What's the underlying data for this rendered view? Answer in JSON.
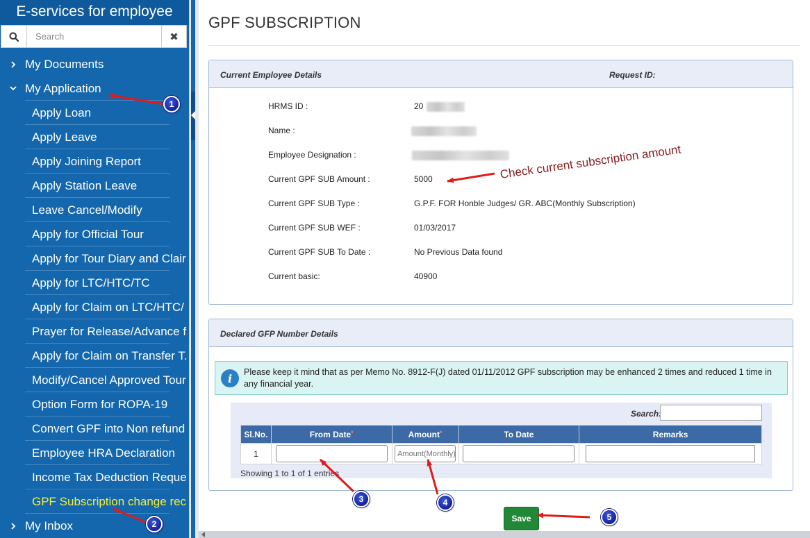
{
  "sidebar": {
    "title": "E-services for employee",
    "search_placeholder": "Search",
    "search_icon": "search-icon",
    "clear_icon": "close-icon",
    "clear_glyph": "✖",
    "items": [
      {
        "label": "My Documents",
        "level": "top",
        "chevron": "›"
      },
      {
        "label": "My Application",
        "level": "top",
        "chevron": "⌄"
      },
      {
        "label": "Apply Loan",
        "level": "sub"
      },
      {
        "label": "Apply Leave",
        "level": "sub"
      },
      {
        "label": "Apply Joining Report",
        "level": "sub"
      },
      {
        "label": "Apply Station Leave",
        "level": "sub"
      },
      {
        "label": "Leave Cancel/Modify",
        "level": "sub"
      },
      {
        "label": "Apply for Official Tour",
        "level": "sub"
      },
      {
        "label": "Apply for Tour Diary and Clair",
        "level": "sub"
      },
      {
        "label": "Apply for LTC/HTC/TC",
        "level": "sub"
      },
      {
        "label": "Apply for Claim on LTC/HTC/",
        "level": "sub"
      },
      {
        "label": "Prayer for Release/Advance f",
        "level": "sub"
      },
      {
        "label": "Apply for Claim on Transfer T.",
        "level": "sub"
      },
      {
        "label": "Modify/Cancel Approved Tour",
        "level": "sub"
      },
      {
        "label": "Option Form for ROPA-19",
        "level": "sub"
      },
      {
        "label": "Convert GPF into Non refund",
        "level": "sub"
      },
      {
        "label": "Employee HRA Declaration",
        "level": "sub"
      },
      {
        "label": "Income Tax Deduction Reque",
        "level": "sub"
      },
      {
        "label": "GPF Subscription change rec",
        "level": "sub",
        "active": true
      },
      {
        "label": "My Inbox",
        "level": "top",
        "chevron": "›"
      }
    ],
    "active_color": "#f3ef3c",
    "bg_color": "#1466ad"
  },
  "page": {
    "title": "GPF SUBSCRIPTION"
  },
  "employee_panel": {
    "heading": "Current Employee Details",
    "request_label": "Request ID:",
    "rows": [
      {
        "label": "HRMS ID :",
        "value": "20",
        "blurred": true
      },
      {
        "label": "Name :",
        "value": "",
        "blurred": true
      },
      {
        "label": "Employee Designation :",
        "value": "",
        "blurred": true
      },
      {
        "label": "Current GPF SUB Amount :",
        "value": "5000"
      },
      {
        "label": "Current GPF SUB Type :",
        "value": "G.P.F. FOR Honble Judges/ GR. ABC(Monthly Subscription)"
      },
      {
        "label": "Current GPF SUB WEF :",
        "value": "01/03/2017"
      },
      {
        "label": "Current GPF SUB To Date :",
        "value": "No Previous Data found"
      },
      {
        "label": "Current basic:",
        "value": "40900"
      }
    ]
  },
  "annotation": {
    "text": "Check current subscription amount",
    "color": "#8b1a1a"
  },
  "declared_panel": {
    "heading": "Declared GFP Number Details",
    "info_icon": "info-icon",
    "info_text": "Please keep it mind that as per Memo No. 8912-F(J) dated 01/11/2012 GPF subscription may be enhanced 2 times and reduced 1 time in any financial year.",
    "grid": {
      "search_label": "Search:",
      "search_value": "",
      "columns": [
        {
          "label": "Sl.No.",
          "required": false
        },
        {
          "label": "From Date",
          "required": true
        },
        {
          "label": "Amount",
          "required": true
        },
        {
          "label": "To Date",
          "required": false
        },
        {
          "label": "Remarks",
          "required": false
        }
      ],
      "required_marker": "*",
      "rows": [
        {
          "sl": "1",
          "from_date": "",
          "amount_placeholder": "Amount(Monthly)",
          "to_date": "",
          "remarks": ""
        }
      ],
      "footer": "Showing 1 to 1 of 1 entries"
    },
    "header_color": "#3b6aa6"
  },
  "actions": {
    "save_label": "Save",
    "save_color": "#218838"
  },
  "callouts": [
    "1",
    "2",
    "3",
    "4",
    "5"
  ],
  "colors": {
    "arrow": "#e11a1a",
    "badge": "#16239a"
  }
}
